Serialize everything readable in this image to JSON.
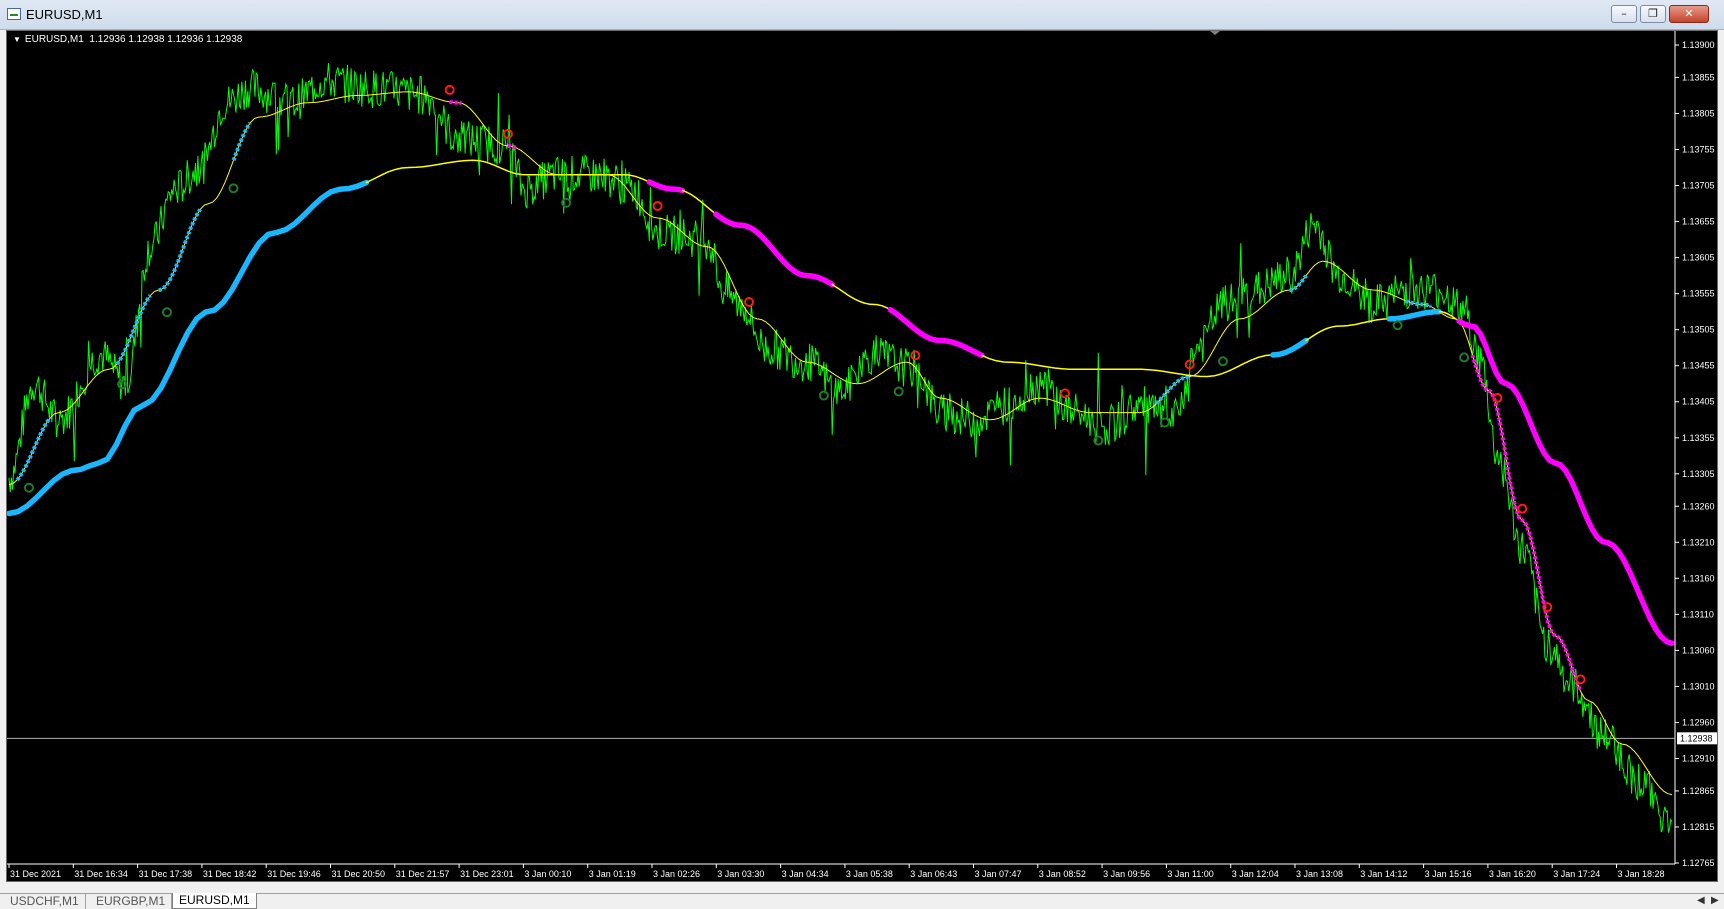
{
  "window": {
    "title": "EURUSD,M1",
    "minimize_icon": "minimize-icon",
    "maximize_icon": "restore-icon",
    "close_icon": "close-icon"
  },
  "chart_header": {
    "symbol": "EURUSD,M1",
    "ohlc": "1.12936 1.12938 1.12936 1.12938"
  },
  "tabs": [
    {
      "label": "USDCHF,M1",
      "active": false
    },
    {
      "label": "EURGBP,M1",
      "active": false
    },
    {
      "label": "EURUSD,M1",
      "active": true
    }
  ],
  "colors": {
    "price": "#00ff00",
    "fast_ma": "#ffff00",
    "trend_up": "#1ab6ff",
    "trend_down": "#ff00ff",
    "slow_ma_neutral": "#ffff00",
    "arrow_up": "#1e7a2a",
    "arrow_down": "#ff1a1a",
    "background": "#000000",
    "grid_text": "#ffffff"
  },
  "chart_data": {
    "type": "line",
    "y_ticks": [
      "1.13900",
      "1.13855",
      "1.13805",
      "1.13755",
      "1.13705",
      "1.13655",
      "1.13605",
      "1.13555",
      "1.13505",
      "1.13455",
      "1.13405",
      "1.13355",
      "1.13305",
      "1.13260",
      "1.13210",
      "1.13160",
      "1.13110",
      "1.13060",
      "1.13010",
      "1.12960",
      "1.12910",
      "1.12865",
      "1.12815",
      "1.12765"
    ],
    "ylim": [
      1.12765,
      1.139
    ],
    "x_ticks": [
      "31 Dec 2021",
      "31 Dec 16:34",
      "31 Dec 17:38",
      "31 Dec 18:42",
      "31 Dec 19:46",
      "31 Dec 20:50",
      "31 Dec 21:57",
      "31 Dec 23:01",
      "3 Jan 00:10",
      "3 Jan 01:19",
      "3 Jan 02:26",
      "3 Jan 03:30",
      "3 Jan 04:34",
      "3 Jan 05:38",
      "3 Jan 06:43",
      "3 Jan 07:47",
      "3 Jan 08:52",
      "3 Jan 09:56",
      "3 Jan 11:00",
      "3 Jan 12:04",
      "3 Jan 13:08",
      "3 Jan 14:12",
      "3 Jan 15:16",
      "3 Jan 16:20",
      "3 Jan 17:24",
      "3 Jan 18:28"
    ],
    "current_price": "1.12938",
    "current_price_value": 1.12938,
    "price_anchors": [
      [
        0,
        1.133
      ],
      [
        0.015,
        1.1343
      ],
      [
        0.03,
        1.1338
      ],
      [
        0.055,
        1.1347
      ],
      [
        0.07,
        1.1343
      ],
      [
        0.085,
        1.1362
      ],
      [
        0.1,
        1.137
      ],
      [
        0.115,
        1.1373
      ],
      [
        0.13,
        1.1382
      ],
      [
        0.145,
        1.1384
      ],
      [
        0.17,
        1.1382
      ],
      [
        0.19,
        1.1385
      ],
      [
        0.22,
        1.1384
      ],
      [
        0.25,
        1.1383
      ],
      [
        0.27,
        1.1377
      ],
      [
        0.3,
        1.1376
      ],
      [
        0.31,
        1.137
      ],
      [
        0.33,
        1.1372
      ],
      [
        0.355,
        1.1372
      ],
      [
        0.375,
        1.137
      ],
      [
        0.39,
        1.1364
      ],
      [
        0.42,
        1.1363
      ],
      [
        0.43,
        1.1356
      ],
      [
        0.44,
        1.1354
      ],
      [
        0.455,
        1.1348
      ],
      [
        0.48,
        1.1346
      ],
      [
        0.5,
        1.1342
      ],
      [
        0.52,
        1.1347
      ],
      [
        0.545,
        1.1345
      ],
      [
        0.56,
        1.1339
      ],
      [
        0.58,
        1.1338
      ],
      [
        0.6,
        1.134
      ],
      [
        0.62,
        1.1343
      ],
      [
        0.64,
        1.1339
      ],
      [
        0.66,
        1.1337
      ],
      [
        0.68,
        1.134
      ],
      [
        0.7,
        1.1338
      ],
      [
        0.715,
        1.1348
      ],
      [
        0.73,
        1.1354
      ],
      [
        0.75,
        1.1356
      ],
      [
        0.77,
        1.1358
      ],
      [
        0.785,
        1.1365
      ],
      [
        0.8,
        1.1358
      ],
      [
        0.82,
        1.1354
      ],
      [
        0.84,
        1.1356
      ],
      [
        0.86,
        1.1356
      ],
      [
        0.875,
        1.1353
      ],
      [
        0.885,
        1.1346
      ],
      [
        0.895,
        1.1333
      ],
      [
        0.91,
        1.132
      ],
      [
        0.925,
        1.1307
      ],
      [
        0.94,
        1.1301
      ],
      [
        0.96,
        1.1294
      ],
      [
        0.98,
        1.1288
      ],
      [
        1.0,
        1.1282
      ]
    ],
    "fast_ma_anchors": [
      [
        0,
        1.1329
      ],
      [
        0.03,
        1.1339
      ],
      [
        0.06,
        1.1345
      ],
      [
        0.09,
        1.1356
      ],
      [
        0.12,
        1.1368
      ],
      [
        0.15,
        1.138
      ],
      [
        0.18,
        1.1382
      ],
      [
        0.21,
        1.1383
      ],
      [
        0.24,
        1.13835
      ],
      [
        0.27,
        1.1382
      ],
      [
        0.3,
        1.1376
      ],
      [
        0.33,
        1.1372
      ],
      [
        0.36,
        1.1372
      ],
      [
        0.39,
        1.1366
      ],
      [
        0.42,
        1.1362
      ],
      [
        0.45,
        1.1352
      ],
      [
        0.48,
        1.1346
      ],
      [
        0.51,
        1.1343
      ],
      [
        0.54,
        1.1346
      ],
      [
        0.56,
        1.1341
      ],
      [
        0.59,
        1.1338
      ],
      [
        0.62,
        1.1341
      ],
      [
        0.65,
        1.1339
      ],
      [
        0.68,
        1.1339
      ],
      [
        0.71,
        1.1344
      ],
      [
        0.74,
        1.1352
      ],
      [
        0.77,
        1.1356
      ],
      [
        0.79,
        1.136
      ],
      [
        0.82,
        1.1356
      ],
      [
        0.85,
        1.1354
      ],
      [
        0.87,
        1.1352
      ],
      [
        0.89,
        1.1342
      ],
      [
        0.91,
        1.1324
      ],
      [
        0.93,
        1.1308
      ],
      [
        0.95,
        1.1299
      ],
      [
        0.97,
        1.1293
      ],
      [
        1.0,
        1.1286
      ]
    ],
    "slow_ma_anchors": [
      [
        0,
        1.1325
      ],
      [
        0.04,
        1.1331
      ],
      [
        0.055,
        1.1332
      ],
      [
        0.08,
        1.134
      ],
      [
        0.12,
        1.1353
      ],
      [
        0.16,
        1.1364
      ],
      [
        0.2,
        1.137
      ],
      [
        0.24,
        1.1373
      ],
      [
        0.28,
        1.1374
      ],
      [
        0.31,
        1.1372
      ],
      [
        0.34,
        1.1372
      ],
      [
        0.37,
        1.1372
      ],
      [
        0.4,
        1.137
      ],
      [
        0.44,
        1.1365
      ],
      [
        0.48,
        1.1358
      ],
      [
        0.52,
        1.1354
      ],
      [
        0.56,
        1.1349
      ],
      [
        0.6,
        1.1346
      ],
      [
        0.64,
        1.1345
      ],
      [
        0.68,
        1.1345
      ],
      [
        0.72,
        1.1344
      ],
      [
        0.76,
        1.1347
      ],
      [
        0.8,
        1.1351
      ],
      [
        0.83,
        1.1352
      ],
      [
        0.86,
        1.1353
      ],
      [
        0.88,
        1.1351
      ],
      [
        0.9,
        1.1343
      ],
      [
        0.93,
        1.1332
      ],
      [
        0.96,
        1.1321
      ],
      [
        1.0,
        1.1307
      ]
    ],
    "slow_ma_segments": [
      {
        "from": 0.0,
        "to": 0.215,
        "trend": "up"
      },
      {
        "from": 0.215,
        "to": 0.385,
        "trend": "neutral"
      },
      {
        "from": 0.385,
        "to": 0.405,
        "trend": "down"
      },
      {
        "from": 0.405,
        "to": 0.425,
        "trend": "neutral"
      },
      {
        "from": 0.425,
        "to": 0.495,
        "trend": "down"
      },
      {
        "from": 0.495,
        "to": 0.53,
        "trend": "neutral"
      },
      {
        "from": 0.53,
        "to": 0.585,
        "trend": "down"
      },
      {
        "from": 0.585,
        "to": 0.76,
        "trend": "neutral"
      },
      {
        "from": 0.76,
        "to": 0.78,
        "trend": "up"
      },
      {
        "from": 0.78,
        "to": 0.83,
        "trend": "neutral"
      },
      {
        "from": 0.83,
        "to": 0.86,
        "trend": "up"
      },
      {
        "from": 0.86,
        "to": 0.872,
        "trend": "neutral"
      },
      {
        "from": 0.872,
        "to": 1.0,
        "trend": "down"
      }
    ],
    "fast_segments": [
      {
        "from": 0.005,
        "to": 0.025,
        "trend": "up"
      },
      {
        "from": 0.065,
        "to": 0.085,
        "trend": "up"
      },
      {
        "from": 0.09,
        "to": 0.115,
        "trend": "up"
      },
      {
        "from": 0.135,
        "to": 0.145,
        "trend": "up"
      },
      {
        "from": 0.265,
        "to": 0.272,
        "trend": "down"
      },
      {
        "from": 0.3,
        "to": 0.305,
        "trend": "down"
      },
      {
        "from": 0.69,
        "to": 0.71,
        "trend": "up"
      },
      {
        "from": 0.77,
        "to": 0.78,
        "trend": "up"
      },
      {
        "from": 0.84,
        "to": 0.855,
        "trend": "up"
      },
      {
        "from": 0.88,
        "to": 0.945,
        "trend": "down"
      }
    ],
    "arrows_up": [
      0.012,
      0.068,
      0.095,
      0.135,
      0.335,
      0.49,
      0.535,
      0.655,
      0.695,
      0.73,
      0.835,
      0.875
    ],
    "arrows_down": [
      0.265,
      0.3,
      0.39,
      0.445,
      0.545,
      0.635,
      0.71,
      0.895,
      0.91,
      0.925,
      0.945
    ]
  }
}
